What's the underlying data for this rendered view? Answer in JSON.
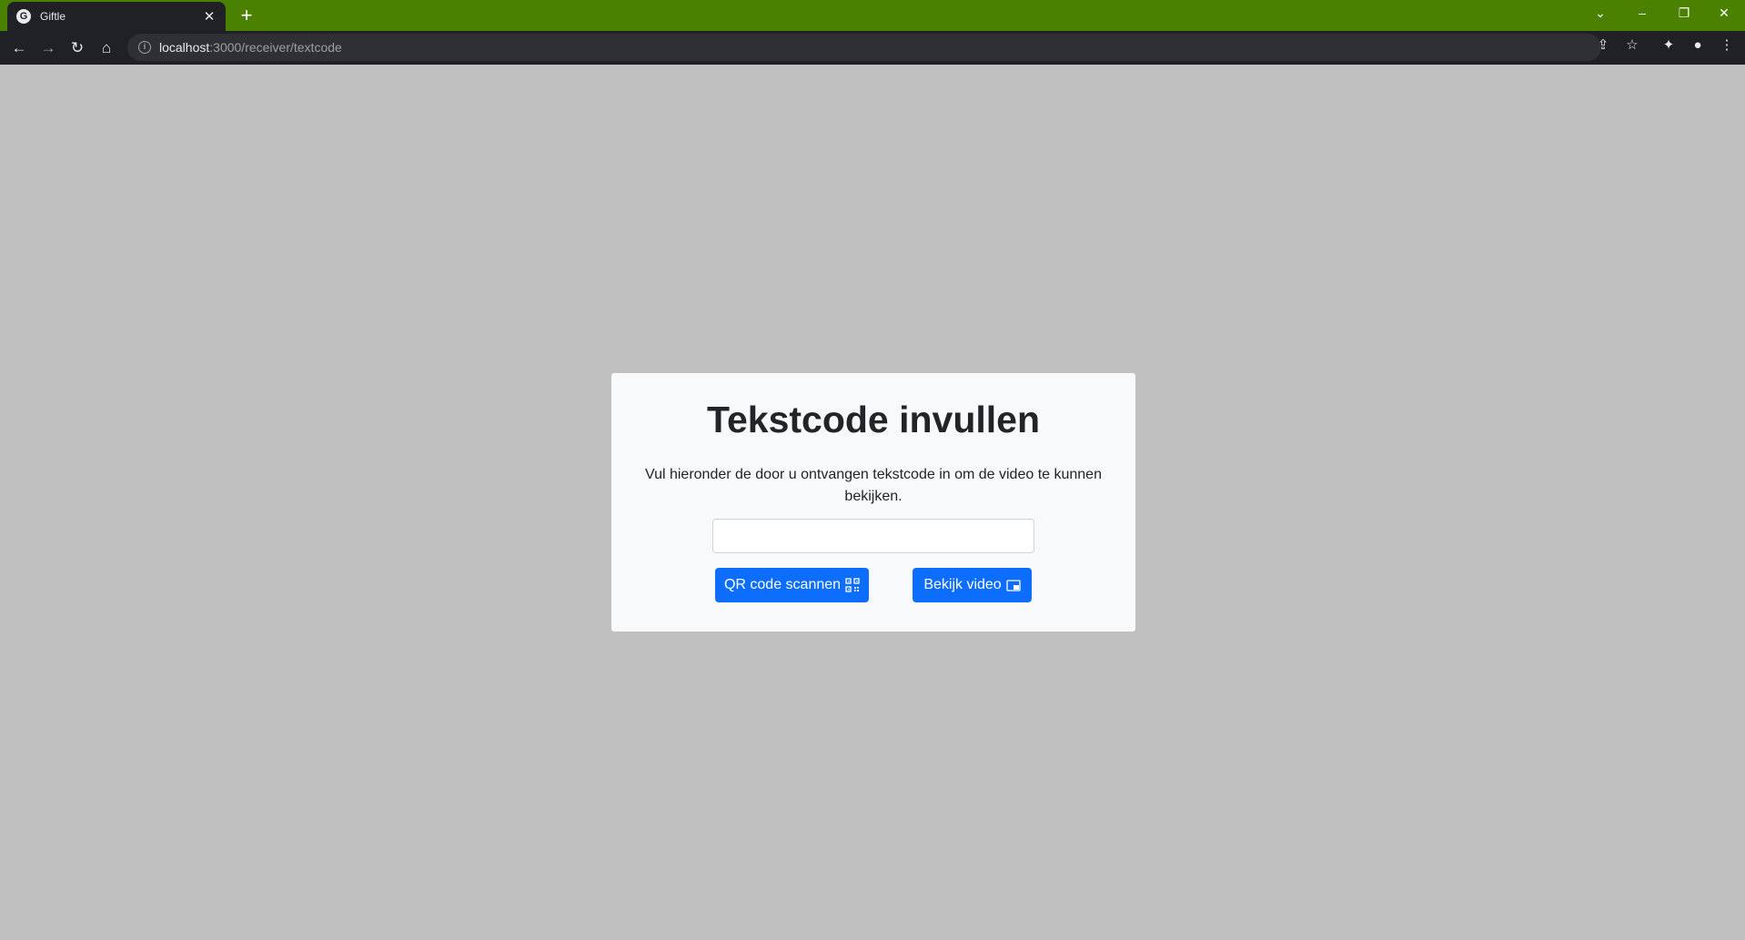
{
  "browser": {
    "tab_title": "Giftle",
    "favicon_letter": "G",
    "tab_close": "✕",
    "new_tab": "+",
    "url_host": "localhost",
    "url_path": ":3000/receiver/textcode",
    "info_glyph": "i",
    "icons": {
      "back": "←",
      "forward": "→",
      "reload": "↻",
      "home": "⌂",
      "share": "⇪",
      "bookmark": "☆",
      "extensions": "✦",
      "profile": "●",
      "menu": "⋮",
      "tab_search": "⌄",
      "minimize": "–",
      "restore": "❐",
      "close": "✕"
    }
  },
  "card": {
    "title": "Tekstcode invullen",
    "description": "Vul hieronder de door u ontvangen tekstcode in om de video te kunnen bekijken.",
    "code_input_value": "",
    "qr_button_label": "QR code scannen",
    "video_button_label": "Bekijk video"
  },
  "colors": {
    "tabstrip": "#4a8100",
    "page_background": "#c0c0c0",
    "card_background": "#f8f9fa",
    "primary": "#0d6efd"
  }
}
